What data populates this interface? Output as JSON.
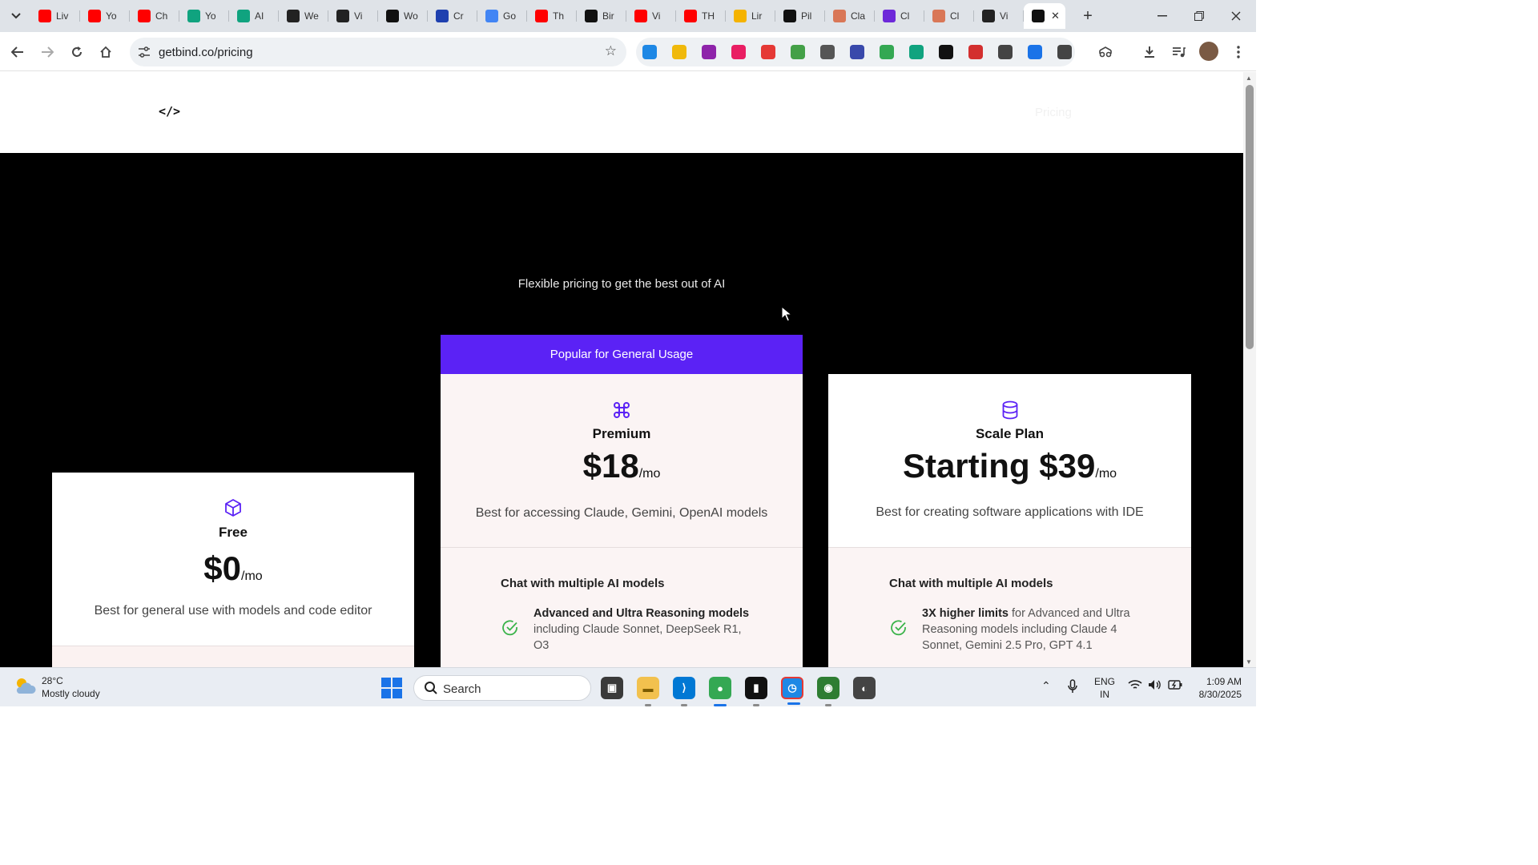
{
  "browser": {
    "tabs": [
      {
        "title": "Liv",
        "icon": "youtube-icon",
        "color": "#ff0000"
      },
      {
        "title": "Yo",
        "icon": "youtube-icon",
        "color": "#ff0000"
      },
      {
        "title": "Ch",
        "icon": "youtube-icon",
        "color": "#ff0000"
      },
      {
        "title": "Yo",
        "icon": "openai-icon",
        "color": "#10a37f"
      },
      {
        "title": "AI",
        "icon": "openai-icon",
        "color": "#10a37f"
      },
      {
        "title": "We",
        "icon": "table-icon",
        "color": "#222222"
      },
      {
        "title": "Vi",
        "icon": "chatgpt-icon",
        "color": "#222222"
      },
      {
        "title": "Wo",
        "icon": "word-icon",
        "color": "#111111"
      },
      {
        "title": "Cr",
        "icon": "iq-icon",
        "color": "#1e40af"
      },
      {
        "title": "Go",
        "icon": "google-icon",
        "color": "#4285f4"
      },
      {
        "title": "Th",
        "icon": "youtube-icon",
        "color": "#ff0000"
      },
      {
        "title": "Bir",
        "icon": "code-icon",
        "color": "#111111"
      },
      {
        "title": "Vi",
        "icon": "youtube-icon",
        "color": "#ff0000"
      },
      {
        "title": "TH",
        "icon": "youtube-icon",
        "color": "#ff0000"
      },
      {
        "title": "Lir",
        "icon": "diamond-icon",
        "color": "#f5b300"
      },
      {
        "title": "Pil",
        "icon": "a-icon",
        "color": "#111111"
      },
      {
        "title": "Cla",
        "icon": "claude-icon",
        "color": "#d97757"
      },
      {
        "title": "Cl",
        "icon": "forms-icon",
        "color": "#6d28d9"
      },
      {
        "title": "Cl",
        "icon": "claude-icon",
        "color": "#d97757"
      },
      {
        "title": "Vi",
        "icon": "chatgpt-icon",
        "color": "#222222"
      },
      {
        "title": "",
        "icon": "code-icon",
        "color": "#111111",
        "active": true
      }
    ],
    "url": "getbind.co/pricing",
    "extensions": [
      {
        "icon": "snowflake-icon",
        "color": "#1e88e5"
      },
      {
        "icon": "binance-icon",
        "color": "#f0b90b"
      },
      {
        "icon": "chat-bubble-icon",
        "color": "#8e24aa"
      },
      {
        "icon": "ring-icon",
        "color": "#e91e63"
      },
      {
        "icon": "shield-icon",
        "color": "#e53935"
      },
      {
        "icon": "globe-icon",
        "color": "#43a047"
      },
      {
        "icon": "dots-icon",
        "color": "#555555"
      },
      {
        "icon": "image-icon",
        "color": "#3949ab"
      },
      {
        "icon": "translate-icon",
        "color": "#34a853"
      },
      {
        "icon": "openai-icon",
        "color": "#10a37f"
      },
      {
        "icon": "ht-icon",
        "color": "#111111"
      },
      {
        "icon": "pdf-icon",
        "color": "#d32f2f"
      },
      {
        "icon": "bookmark-icon",
        "color": "#444444"
      },
      {
        "icon": "dot-icon",
        "color": "#1a73e8"
      },
      {
        "icon": "puzzle-icon",
        "color": "#444444"
      }
    ]
  },
  "site": {
    "logo": "</>",
    "nav_pricing": "Pricing",
    "tagline": "Flexible pricing to get the best out of AI",
    "plans": {
      "free": {
        "name": "Free",
        "price": "$0",
        "unit": "/mo",
        "description": "Best for general use with models and code editor",
        "icon": "cube-icon"
      },
      "premium": {
        "banner": "Popular for General Usage",
        "name": "Premium",
        "price": "$18",
        "unit": "/mo",
        "description": "Best for accessing Claude, Gemini, OpenAI models",
        "icon": "command-icon",
        "section_title": "Chat with multiple AI models",
        "feature_bold": "Advanced and Ultra Reasoning models",
        "feature_rest": "including Claude Sonnet, DeepSeek R1, O3"
      },
      "scale": {
        "name": "Scale Plan",
        "price": "Starting $39",
        "unit": "/mo",
        "description": "Best for creating software applications with IDE",
        "icon": "database-icon",
        "section_title": "Chat with multiple AI models",
        "feature_bold": "3X higher limits",
        "feature_rest": "for Advanced and Ultra Reasoning models including Claude 4 Sonnet, Gemini 2.5 Pro, GPT 4.1"
      }
    }
  },
  "taskbar": {
    "weather_temp": "28°C",
    "weather_desc": "Mostly cloudy",
    "search_label": "Search",
    "lang_line1": "ENG",
    "lang_line2": "IN",
    "time": "1:09 AM",
    "date": "8/30/2025"
  },
  "colors": {
    "accent": "#5b22f5",
    "check": "#3ab34a"
  }
}
